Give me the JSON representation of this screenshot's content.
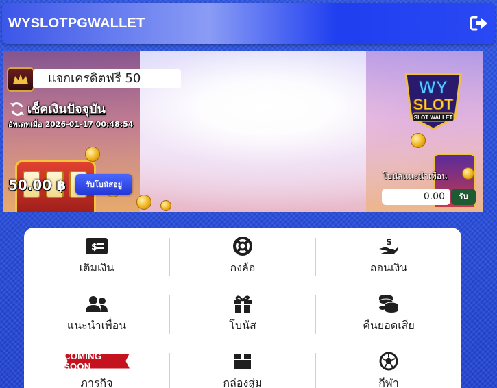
{
  "header": {
    "title": "WYSLOTPGWALLET",
    "logout_icon": "logout-icon"
  },
  "banner": {
    "promo_text": "แจกเครดิตฟรี 50",
    "check_balance_label": "เช็คเงินปัจจุบัน",
    "updated_at": "อัพเดทเมื่อ 2026-01-17 00:48:54",
    "balance": "50.00 ฿",
    "claim_bonus_label": "รับโบนัสอยู่",
    "brand_logo_text": [
      "WY",
      "SLOT",
      "SLOT WALLET"
    ],
    "referral_label": "โบนัสแนะนำเพื่อน",
    "referral_value": "0.00",
    "referral_claim_label": "รับ"
  },
  "menu": {
    "items": [
      {
        "label": "เติมเงิน",
        "icon": "money-bill-icon"
      },
      {
        "label": "กงล้อ",
        "icon": "life-ring-icon"
      },
      {
        "label": "ถอนเงิน",
        "icon": "hand-dollar-icon"
      },
      {
        "label": "แนะนำเพื่อน",
        "icon": "users-icon"
      },
      {
        "label": "โบนัส",
        "icon": "gift-icon"
      },
      {
        "label": "คืนยอดเสีย",
        "icon": "coins-icon"
      },
      {
        "label": "ภารกิจ",
        "icon": "coming-soon-badge",
        "badge": "COMING SOON"
      },
      {
        "label": "กล่องสุ่ม",
        "icon": "box-icon"
      },
      {
        "label": "กีฬา",
        "icon": "soccer-ball-icon"
      }
    ]
  },
  "colors": {
    "background": "#2a4fe0",
    "header_accent": "#1f3ff0",
    "claim_button": "#2338d6",
    "referral_claim_button": "#1e5a32",
    "coming_soon": "#c4131f"
  }
}
